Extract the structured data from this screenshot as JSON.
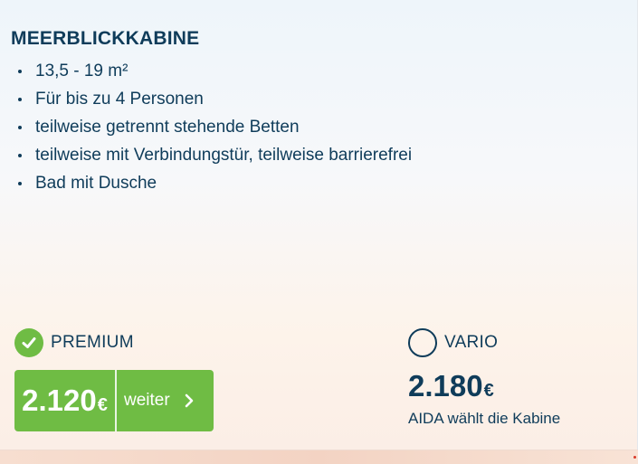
{
  "cabin": {
    "title": "MEERBLICKKABINE",
    "features": [
      "13,5 - 19 m²",
      "Für bis zu 4 Personen",
      "teilweise getrennt stehende Betten",
      "teilweise mit Verbindungstür, teilweise barrierefrei",
      "Bad mit Dusche"
    ]
  },
  "tariffs": {
    "premium": {
      "name": "PREMIUM",
      "selected": true,
      "price": "2.120",
      "currency": "€",
      "button_label": "weiter"
    },
    "vario": {
      "name": "VARIO",
      "selected": false,
      "price": "2.180",
      "currency": "€",
      "note": "AIDA wählt die Kabine"
    }
  },
  "colors": {
    "accent_green": "#6fbc44",
    "text_navy": "#0f3c5a"
  },
  "icons": {
    "premium_radio": "check-circle-icon",
    "vario_radio": "empty-radio-icon",
    "button_arrow": "chevron-right-icon"
  }
}
